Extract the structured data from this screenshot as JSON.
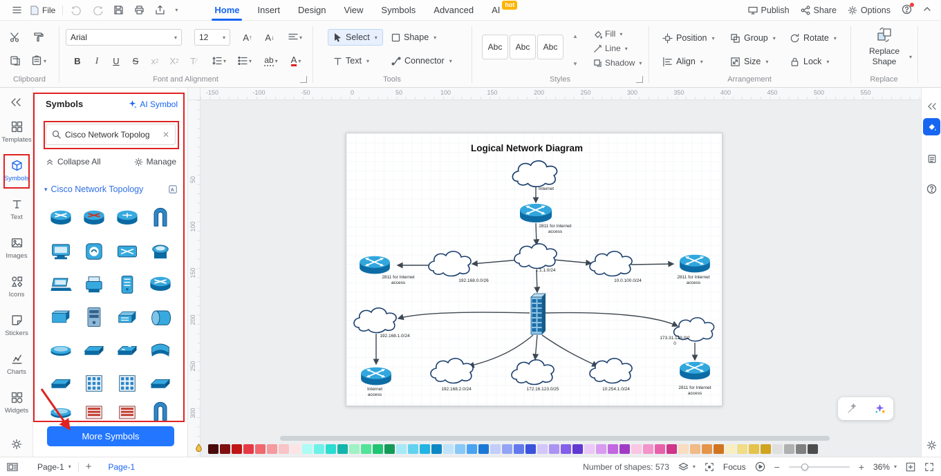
{
  "app": {
    "accent": "#1766f2",
    "annotation_red": "#e02222",
    "cisco_blue": "#37a9de"
  },
  "titlebar": {
    "file_label": "File",
    "tabs": [
      {
        "label": "Home",
        "active": true
      },
      {
        "label": "Insert",
        "active": false
      },
      {
        "label": "Design",
        "active": false
      },
      {
        "label": "View",
        "active": false
      },
      {
        "label": "Symbols",
        "active": false
      },
      {
        "label": "Advanced",
        "active": false
      },
      {
        "label": "AI",
        "active": false,
        "badge": "hot"
      }
    ],
    "publish_label": "Publish",
    "share_label": "Share",
    "options_label": "Options"
  },
  "ribbon": {
    "section_labels": {
      "clipboard": "Clipboard",
      "font": "Font and Alignment",
      "tools": "Tools",
      "styles": "Styles",
      "arrangement": "Arrangement",
      "replace": "Replace"
    },
    "font_family": "Arial",
    "font_size": "12",
    "tools": {
      "select": "Select",
      "shape": "Shape",
      "text": "Text",
      "connector": "Connector"
    },
    "styles": {
      "samples": [
        "Abc",
        "Abc",
        "Abc"
      ],
      "fill": "Fill",
      "line": "Line",
      "shadow": "Shadow"
    },
    "arrangement": {
      "position": "Position",
      "group": "Group",
      "rotate": "Rotate",
      "align": "Align",
      "size": "Size",
      "lock": "Lock"
    },
    "replace_label": "Replace Shape"
  },
  "left_nav": {
    "items": [
      {
        "label": "Templates",
        "active": false
      },
      {
        "label": "Symbols",
        "active": true
      },
      {
        "label": "Text",
        "active": false
      },
      {
        "label": "Images",
        "active": false
      },
      {
        "label": "Icons",
        "active": false
      },
      {
        "label": "Stickers",
        "active": false
      },
      {
        "label": "Charts",
        "active": false
      },
      {
        "label": "Widgets",
        "active": false
      }
    ]
  },
  "symbols_panel": {
    "title": "Symbols",
    "ai_symbol_label": "AI Symbol",
    "search_value": "Cisco Network Topolog",
    "collapse_all_label": "Collapse All",
    "manage_label": "Manage",
    "section_title": "Cisco Network Topology",
    "more_symbols_label": "More Symbols",
    "tiles": [
      {
        "name": "router"
      },
      {
        "name": "atm-router"
      },
      {
        "name": "router-plain"
      },
      {
        "name": "bridge"
      },
      {
        "name": "workstation"
      },
      {
        "name": "protocol-translator"
      },
      {
        "name": "atm-switch"
      },
      {
        "name": "terminal"
      },
      {
        "name": "laptop"
      },
      {
        "name": "printer"
      },
      {
        "name": "communications-server"
      },
      {
        "name": "router"
      },
      {
        "name": "hub"
      },
      {
        "name": "file-server"
      },
      {
        "name": "switch-3d"
      },
      {
        "name": "storage"
      },
      {
        "name": "flat-disc"
      },
      {
        "name": "flat-slab"
      },
      {
        "name": "workgroup-switch"
      },
      {
        "name": "curve-slab"
      },
      {
        "name": "flat-slab"
      },
      {
        "name": "matrix-switch"
      },
      {
        "name": "matrix-switch"
      },
      {
        "name": "flat-slab"
      },
      {
        "name": "flat-disc"
      },
      {
        "name": "matrix-red"
      },
      {
        "name": "matrix-red"
      },
      {
        "name": "bridge"
      }
    ]
  },
  "canvas": {
    "ruler_h": [
      "-150",
      "-100",
      "-50",
      "0",
      "50",
      "100",
      "150",
      "200",
      "250",
      "300",
      "350",
      "400",
      "450",
      "500",
      "550"
    ],
    "ruler_v": [
      "50",
      "100",
      "150",
      "200",
      "250",
      "300"
    ]
  },
  "diagram": {
    "title": "Logical Network Diagram",
    "labels": {
      "internet": "Internet",
      "router_top": "2811 for Internet access",
      "net_mid": "1.1.1.0/24",
      "net_left": "192.168.0.0/26",
      "router_left": "2811 for Internet access",
      "net_right": "10.0.100.0/24",
      "router_right": "2811 for Internet access",
      "net_lower_left": "192.168.1.0/24",
      "router_bottom_left": "Internet access",
      "net_bottom_2": "192.168.2.0/24",
      "net_bottom_3": "172.16.123.0/25",
      "net_bottom_4": "10.254.1.0/24",
      "net_right_mid": "173.31.128.0/20",
      "router_bottom_right": "2811 for Internet access"
    }
  },
  "palette": {
    "colors": [
      "#4a0a0a",
      "#801010",
      "#c01616",
      "#e63946",
      "#f0696e",
      "#f59a9d",
      "#f9c4c6",
      "#fce4e5",
      "#aefcf6",
      "#6ef2e8",
      "#2bdcd0",
      "#12b5aa",
      "#9ff2c4",
      "#52e396",
      "#1fc573",
      "#149a58",
      "#a6e9f7",
      "#62d2f0",
      "#23b4e4",
      "#0e88c3",
      "#bfe3fb",
      "#86c8f7",
      "#4aa3f0",
      "#1a78d6",
      "#c3cdfa",
      "#93a4f5",
      "#6279ee",
      "#3b52dd",
      "#d2c6fa",
      "#ab93f3",
      "#845fe9",
      "#6138d2",
      "#ecc8f8",
      "#d99af0",
      "#c266e2",
      "#a13bc6",
      "#fac6e3",
      "#f394ca",
      "#e960aa",
      "#cf3588",
      "#f8ddc0",
      "#f0bb86",
      "#e5954a",
      "#d0741f",
      "#f8eec0",
      "#f0dd86",
      "#e5c24a",
      "#d0a41f",
      "#e0e0e0",
      "#b0b0b0",
      "#808080",
      "#4d4d4d"
    ]
  },
  "statusbar": {
    "page_selector": "Page-1",
    "page_tab": "Page-1",
    "shape_count": "Number of shapes: 573",
    "focus_label": "Focus",
    "zoom_value": "36%"
  }
}
